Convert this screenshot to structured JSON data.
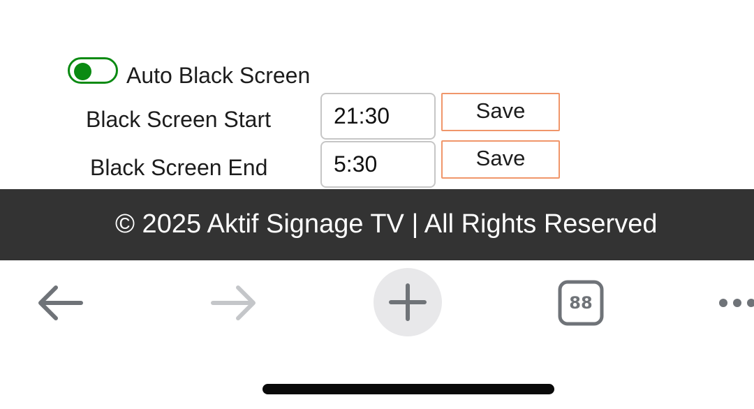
{
  "settings": {
    "auto_black_screen": {
      "label": "Auto Black Screen",
      "enabled": true
    },
    "start": {
      "label": "Black Screen Start",
      "value": "21:30",
      "save_label": "Save"
    },
    "end": {
      "label": "Black Screen End",
      "value": "5:30",
      "save_label": "Save"
    }
  },
  "footer": {
    "text": "© 2025 Aktif Signage TV | All Rights Reserved"
  },
  "browser_toolbar": {
    "back_icon": "arrow-left-icon",
    "forward_icon": "arrow-right-icon",
    "new_tab_icon": "plus-icon",
    "tab_count": "88",
    "more_icon": "more-dots-icon"
  },
  "colors": {
    "toggle_on": "#0a8a12",
    "save_border": "#f0966a",
    "footer_bg": "#333333"
  }
}
